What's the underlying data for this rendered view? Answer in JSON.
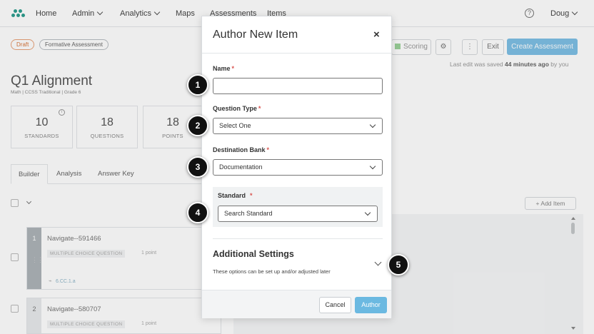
{
  "nav": {
    "items": [
      {
        "label": "Home",
        "dropdown": false
      },
      {
        "label": "Admin",
        "dropdown": true
      },
      {
        "label": "Analytics",
        "dropdown": true
      },
      {
        "label": "Maps",
        "dropdown": false
      },
      {
        "label": "Assessments",
        "dropdown": false
      },
      {
        "label": "Items",
        "dropdown": false
      }
    ],
    "help_icon": "?",
    "user": "Doug"
  },
  "assessment": {
    "status_pills": [
      "Draft",
      "Formative Assessment"
    ],
    "title": "Q1 Alignment",
    "subtitle": "Math | CCSS Traditional | Grade 6",
    "toolbar": {
      "scoring_label": "Scoring",
      "exit_label": "Exit",
      "create_label": "Create Assessment"
    },
    "last_edit_prefix": "Last edit was saved",
    "last_edit_time": "44 minutes ago",
    "last_edit_suffix": "by you",
    "stats": [
      {
        "value": "10",
        "label": "STANDARDS"
      },
      {
        "value": "18",
        "label": "QUESTIONS"
      },
      {
        "value": "18",
        "label": "POINTS"
      }
    ],
    "tabs": [
      "Builder",
      "Analysis",
      "Answer Key"
    ],
    "add_item_label": "Add Item",
    "items": [
      {
        "number": "1",
        "title": "Navigate--591466",
        "type": "MULTIPLE CHOICE QUESTION",
        "points": "1 point",
        "standard": "6.CC.1.a"
      },
      {
        "number": "2",
        "title": "Navigate--580707",
        "type": "MULTIPLE CHOICE QUESTION",
        "points": "1 point"
      }
    ]
  },
  "modal": {
    "title": "Author New Item",
    "close": "×",
    "required_mark": "*",
    "name_label": "Name",
    "name_value": "",
    "question_type_label": "Question Type",
    "question_type_value": "Select One",
    "destination_bank_label": "Destination Bank",
    "destination_bank_value": "Documentation",
    "standard_label": "Standard",
    "standard_value": "Search Standard",
    "additional_title": "Additional Settings",
    "additional_desc": "These options can be set up and/or adjusted later",
    "cancel_label": "Cancel",
    "author_label": "Author"
  },
  "callouts": [
    "1",
    "2",
    "3",
    "4",
    "5"
  ]
}
